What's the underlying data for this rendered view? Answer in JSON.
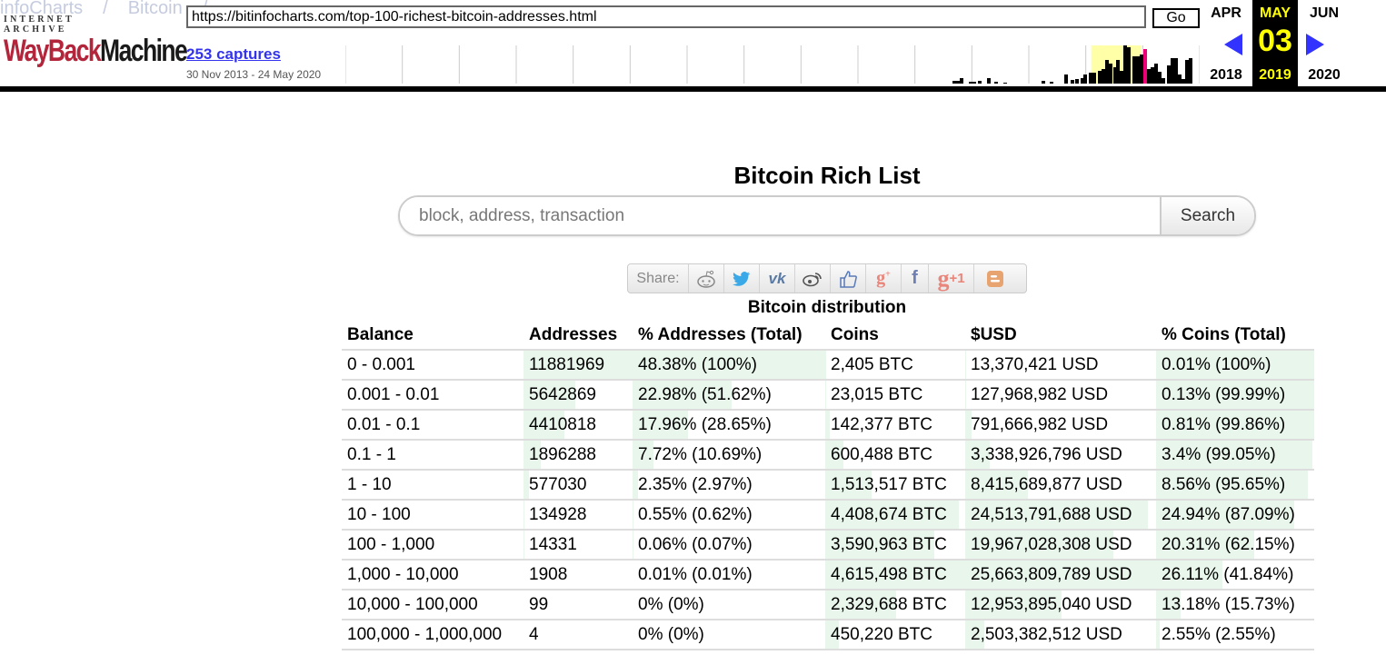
{
  "wayback": {
    "ghost_breadcrumb": [
      "infoCharts",
      "/",
      "Bitcoin",
      "/"
    ],
    "logo_top": "INTERNET ARCHIVE",
    "logo_word_a": "WayBack",
    "logo_word_b": "Machine",
    "url": "https://bitinfocharts.com/top-100-richest-bitcoin-addresses.html",
    "go_label": "Go",
    "captures_label": "253 captures",
    "capture_range": "30 Nov 2013 - 24 May 2020",
    "calendar": {
      "prev_month": "APR",
      "prev_year": "2018",
      "cur_month": "MAY",
      "cur_day": "03",
      "cur_year": "2019",
      "next_month": "JUN",
      "next_year": "2020"
    },
    "colors": {
      "highlight": "#ffff00",
      "arrow": "#3333ff",
      "sparkline_current": "#ee0077",
      "year_band": "#ffffa8"
    }
  },
  "page": {
    "title": "Bitcoin Rich List",
    "search_placeholder": "block, address, transaction",
    "search_button": "Search",
    "share_label": "Share:",
    "share_icons": [
      "reddit-icon",
      "twitter-icon",
      "vk-icon",
      "weibo-icon",
      "like-icon",
      "google-plus-icon",
      "facebook-icon",
      "google-plus-one-icon",
      "blogger-icon"
    ],
    "table_title": "Bitcoin distribution"
  },
  "table": {
    "headers": [
      "Balance",
      "Addresses",
      "% Addresses (Total)",
      "Coins",
      "$USD",
      "% Coins (Total)"
    ],
    "rows": [
      {
        "balance": "0 - 0.001",
        "addresses": "11881969",
        "pct_addresses": "48.38% (100%)",
        "coins": "2,405 BTC",
        "usd": "13,370,421 USD",
        "pct_coins": "0.01% (100%)"
      },
      {
        "balance": "0.001 - 0.01",
        "addresses": "5642869",
        "pct_addresses": "22.98% (51.62%)",
        "coins": "23,015 BTC",
        "usd": "127,968,982 USD",
        "pct_coins": "0.13% (99.99%)"
      },
      {
        "balance": "0.01 - 0.1",
        "addresses": "4410818",
        "pct_addresses": "17.96% (28.65%)",
        "coins": "142,377 BTC",
        "usd": "791,666,982 USD",
        "pct_coins": "0.81% (99.86%)"
      },
      {
        "balance": "0.1 - 1",
        "addresses": "1896288",
        "pct_addresses": "7.72% (10.69%)",
        "coins": "600,488 BTC",
        "usd": "3,338,926,796 USD",
        "pct_coins": "3.4% (99.05%)"
      },
      {
        "balance": "1 - 10",
        "addresses": "577030",
        "pct_addresses": "2.35% (2.97%)",
        "coins": "1,513,517 BTC",
        "usd": "8,415,689,877 USD",
        "pct_coins": "8.56% (95.65%)"
      },
      {
        "balance": "10 - 100",
        "addresses": "134928",
        "pct_addresses": "0.55% (0.62%)",
        "coins": "4,408,674 BTC",
        "usd": "24,513,791,688 USD",
        "pct_coins": "24.94% (87.09%)"
      },
      {
        "balance": "100 - 1,000",
        "addresses": "14331",
        "pct_addresses": "0.06% (0.07%)",
        "coins": "3,590,963 BTC",
        "usd": "19,967,028,308 USD",
        "pct_coins": "20.31% (62.15%)"
      },
      {
        "balance": "1,000 - 10,000",
        "addresses": "1908",
        "pct_addresses": "0.01% (0.01%)",
        "coins": "4,615,498 BTC",
        "usd": "25,663,809,789 USD",
        "pct_coins": "26.11% (41.84%)"
      },
      {
        "balance": "10,000 - 100,000",
        "addresses": "99",
        "pct_addresses": "0% (0%)",
        "coins": "2,329,688 BTC",
        "usd": "12,953,895,040 USD",
        "pct_coins": "13.18% (15.73%)"
      },
      {
        "balance": "100,000 - 1,000,000",
        "addresses": "4",
        "pct_addresses": "0% (0%)",
        "coins": "450,220 BTC",
        "usd": "2,503,382,512 USD",
        "pct_coins": "2.55% (2.55%)"
      }
    ],
    "fill_color": "#e8f6ec"
  }
}
